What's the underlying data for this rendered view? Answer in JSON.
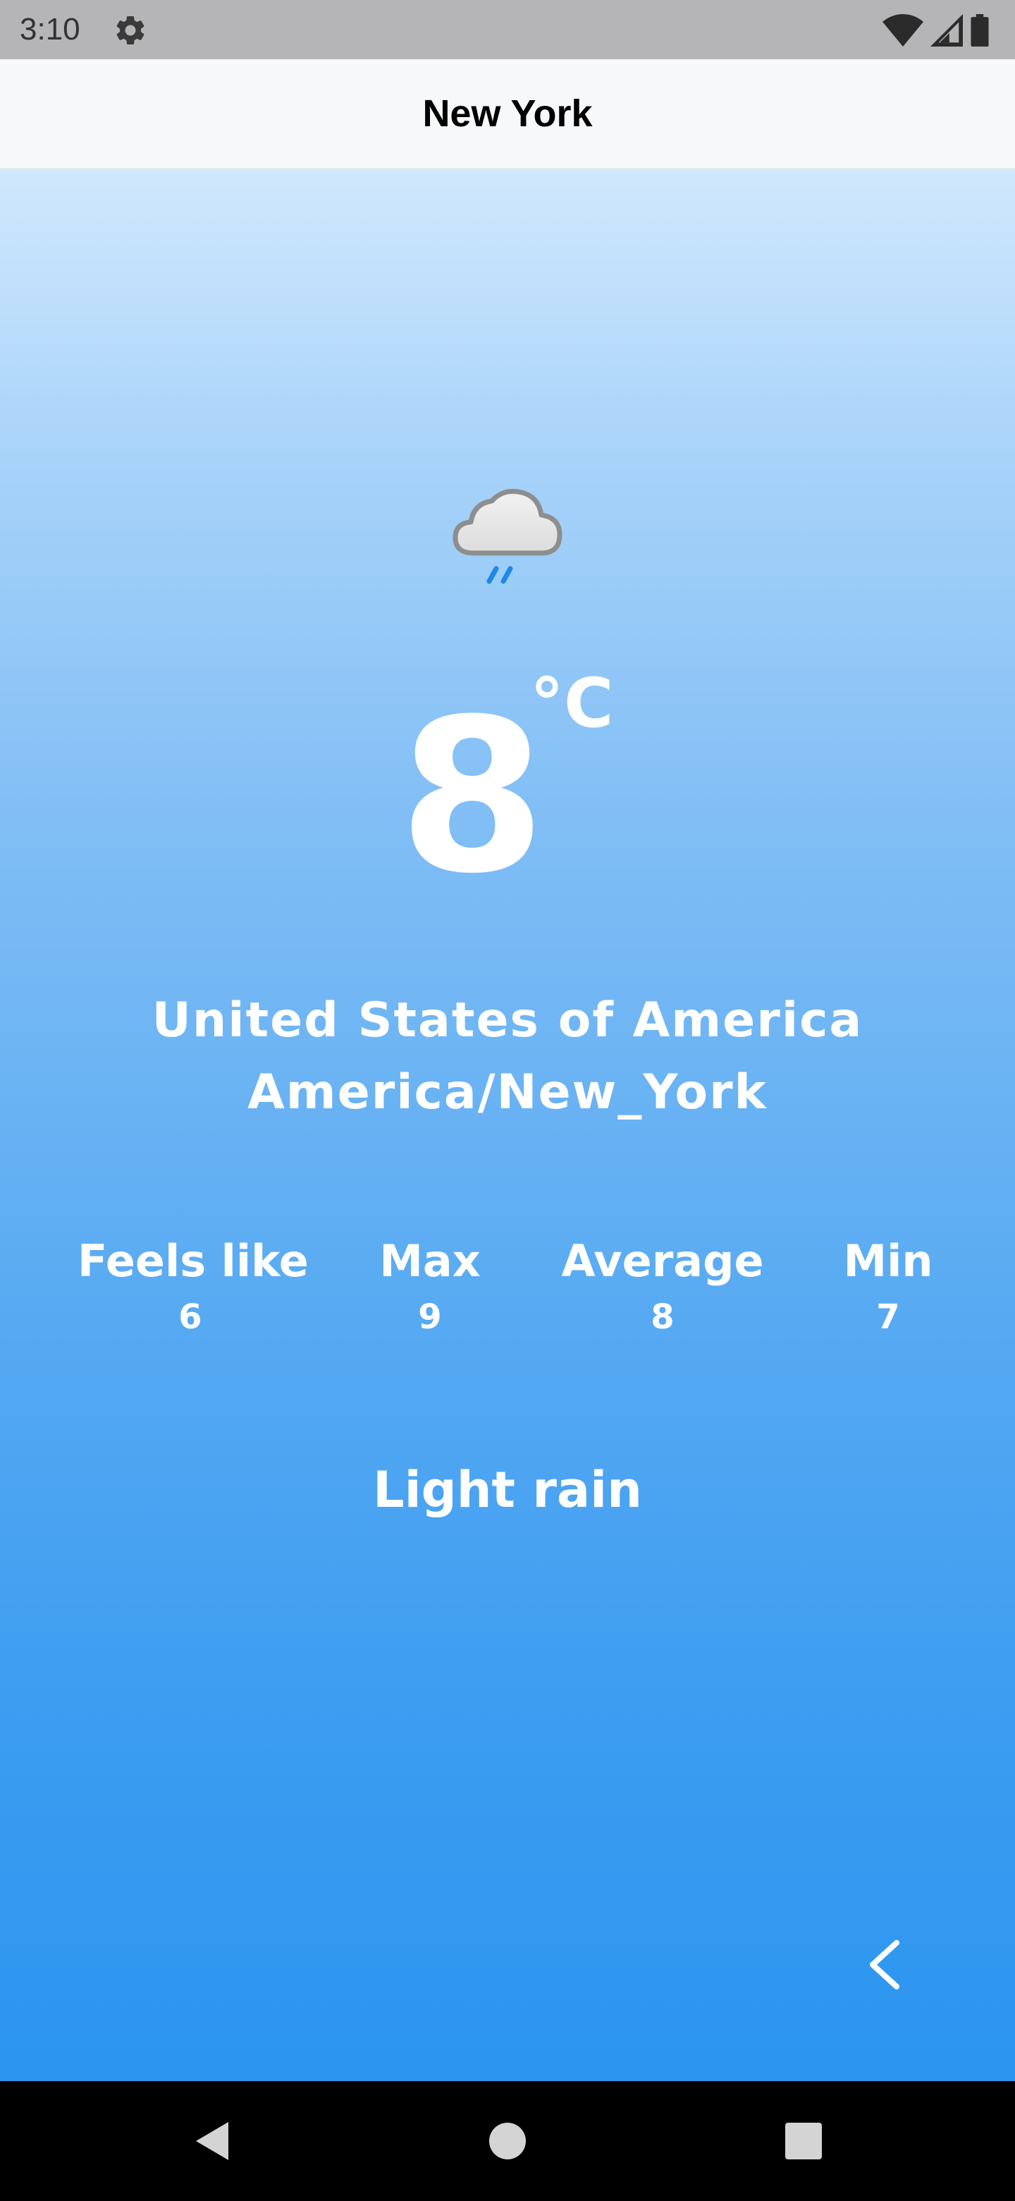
{
  "status_bar": {
    "time": "3:10",
    "icons": [
      "gear-icon",
      "wifi-icon",
      "signal-icon",
      "battery-icon"
    ]
  },
  "app_bar": {
    "title": "New York"
  },
  "weather": {
    "icon": "light-rain-cloud-icon",
    "temperature": "8",
    "unit": "°C",
    "country": "United States of America",
    "timezone": "America/New_York",
    "stats": {
      "feels_like": {
        "label": "Feels like",
        "value": "6"
      },
      "max": {
        "label": "Max",
        "value": "9"
      },
      "average": {
        "label": "Average",
        "value": "8"
      },
      "min": {
        "label": "Min",
        "value": "7"
      }
    },
    "condition": "Light rain"
  },
  "controls": {
    "back_icon": "chevron-left-icon"
  },
  "nav_bar": {
    "buttons": [
      "back-triangle-icon",
      "home-circle-icon",
      "recents-square-icon"
    ]
  },
  "colors": {
    "status_bar_bg": "#b5b5b7",
    "app_bar_bg": "#f7f8fa",
    "gradient_top": "#d0e8fd",
    "gradient_bottom": "#2b95ef",
    "text_primary": "#ffffff",
    "rain_drops": "#1e88e5"
  }
}
